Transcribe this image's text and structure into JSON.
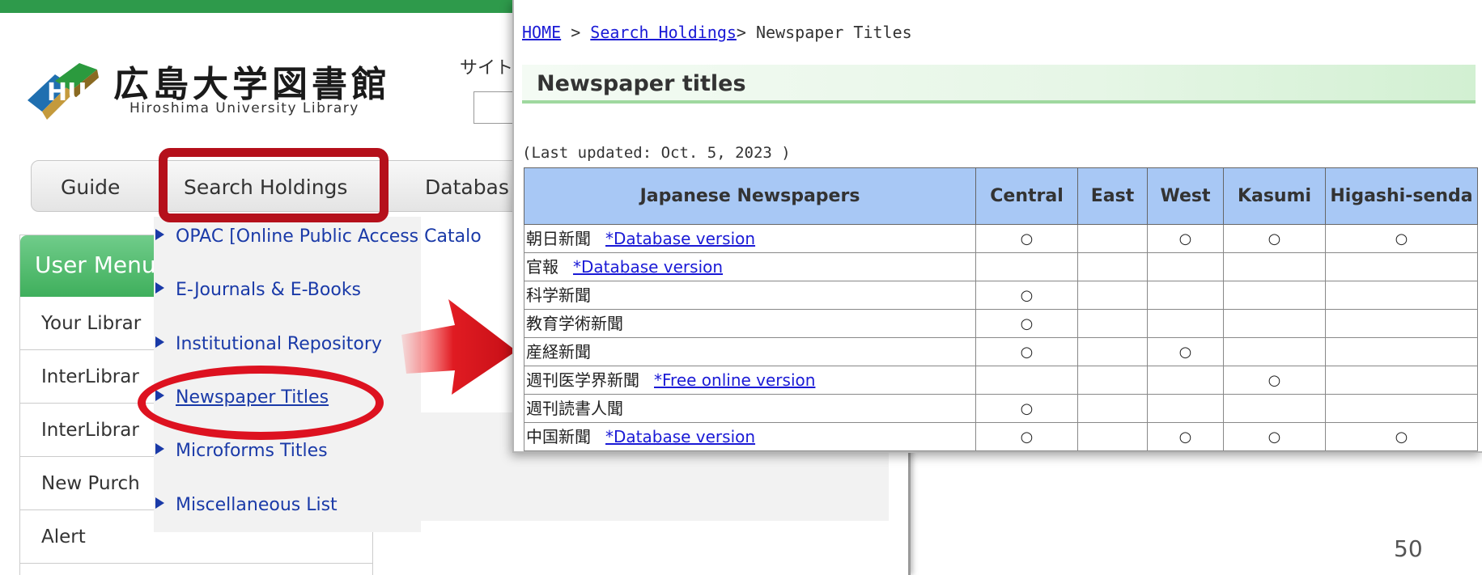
{
  "left_page": {
    "logo": {
      "jp": "広島大学図書館",
      "en": "Hiroshima University Library"
    },
    "site_search_label": "サイト",
    "nav": {
      "guide": "Guide",
      "search_holdings": "Search Holdings",
      "databases": "Databas"
    },
    "user_menu": {
      "title": "User Menu",
      "items": [
        "Your Librar",
        "InterLibrar",
        "InterLibrar",
        "New Purch",
        "Alert"
      ]
    },
    "dropdown": [
      "OPAC [Online Public Access Catalo",
      "E-Journals & E-Books",
      "Institutional Repository",
      "Newspaper Titles",
      "Microforms Titles",
      "Miscellaneous List"
    ]
  },
  "right_page": {
    "breadcrumb": {
      "home": "HOME",
      "sep1": " > ",
      "search": "Search Holdings",
      "sep2": "> ",
      "current": "Newspaper Titles"
    },
    "title": "Newspaper titles",
    "last_updated": "(Last updated: Oct. 5, 2023 )",
    "table": {
      "headers": [
        "Japanese Newspapers",
        "Central",
        "East",
        "West",
        "Kasumi",
        "Higashi-senda"
      ],
      "rows": [
        {
          "title": "朝日新聞",
          "link": "*Database version",
          "central": "○",
          "east": "",
          "west": "○",
          "kasumi": "○",
          "higashi": "○"
        },
        {
          "title": "官報",
          "link": "*Database version",
          "central": "",
          "east": "",
          "west": "",
          "kasumi": "",
          "higashi": ""
        },
        {
          "title": "科学新聞",
          "link": "",
          "central": "○",
          "east": "",
          "west": "",
          "kasumi": "",
          "higashi": ""
        },
        {
          "title": "教育学術新聞",
          "link": "",
          "central": "○",
          "east": "",
          "west": "",
          "kasumi": "",
          "higashi": ""
        },
        {
          "title": "産経新聞",
          "link": "",
          "central": "○",
          "east": "",
          "west": "○",
          "kasumi": "",
          "higashi": ""
        },
        {
          "title": "週刊医学界新聞",
          "link": "*Free online version",
          "central": "",
          "east": "",
          "west": "",
          "kasumi": "○",
          "higashi": ""
        },
        {
          "title": "週刊読書人聞",
          "link": "",
          "central": "○",
          "east": "",
          "west": "",
          "kasumi": "",
          "higashi": ""
        },
        {
          "title": "中国新聞",
          "link": "*Database version",
          "central": "○",
          "east": "",
          "west": "○",
          "kasumi": "○",
          "higashi": "○"
        }
      ]
    }
  },
  "slide_number": "50",
  "colors": {
    "brand_green": "#2e9a4b",
    "highlight_red": "#b5101b",
    "oval_red": "#dd1220",
    "link_blue": "#1a1ad6",
    "table_header_blue": "#a8c8f5"
  },
  "icons": [
    "hu-logo-icon",
    "arrow-right-icon",
    "triangle-bullet-icon"
  ]
}
